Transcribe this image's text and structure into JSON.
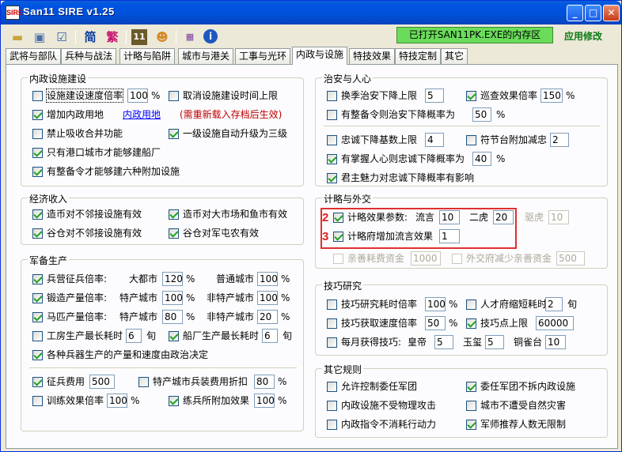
{
  "window": {
    "title": "San11 SIRE v1.25",
    "app_icon": "SIRE"
  },
  "toolbar": {
    "icons": [
      "open-folder-icon",
      "save-disk-icon",
      "checklist-icon",
      "simplified-icon",
      "traditional-icon",
      "calendar-11-icon",
      "officer-face-icon",
      "binary-grid-icon",
      "info-icon"
    ],
    "simplified": "简",
    "traditional": "繁",
    "status": "已打开SAN11PK.EXE的内存区",
    "apply": "应用修改"
  },
  "tabs": [
    "武将与部队",
    "兵种与战法",
    "计略与陷阱",
    "城市与港关",
    "工事与光环",
    "内政与设施",
    "特技效果",
    "特技定制",
    "其它"
  ],
  "active_tab": "内政与设施",
  "left": {
    "g1": {
      "title": "内政设施建设",
      "r1": {
        "label": "设施建设速度倍率",
        "value": "100",
        "unit": "%"
      },
      "r1b": {
        "label": "取消设施建设时间上限"
      },
      "r2": {
        "label": "增加内政用地",
        "link": "内政用地",
        "note": "(需重新载入存档后生效)"
      },
      "r3": {
        "label": "禁止吸收合并功能"
      },
      "r3b": {
        "label": "一级设施自动升级为三级"
      },
      "r4": {
        "label": "只有港口城市才能够建船厂"
      },
      "r5": {
        "label": "有整备令才能够建六种附加设施"
      }
    },
    "g2": {
      "title": "经济收入",
      "a": "造币对不邻接设施有效",
      "b": "造币对大市场和鱼市有效",
      "c": "谷仓对不邻接设施有效",
      "d": "谷仓对军屯农有效"
    },
    "g3": {
      "title": "军备生产",
      "r1": {
        "label": "兵营征兵倍率:",
        "city1": "大都市",
        "v1": "120",
        "city2": "普通城市",
        "v2": "100"
      },
      "r2": {
        "label": "锻造产量倍率:",
        "city1": "特产城市",
        "v1": "100",
        "city2": "非特产城市",
        "v2": "100"
      },
      "r3": {
        "label": "马匹产量倍率:",
        "city1": "特产城市",
        "v1": "80",
        "city2": "非特产城市",
        "v2": "20"
      },
      "r4": {
        "label": "工房生产最长耗时",
        "v1": "6",
        "unit1": "旬",
        "label2": "船厂生产最长耗时",
        "v2": "6",
        "unit2": "旬"
      },
      "r5": {
        "label": "各种兵器生产的产量和速度由政治决定"
      },
      "r6": {
        "label": "征兵费用",
        "v": "500",
        "label2": "特产城市兵装费用折扣",
        "v2": "80"
      },
      "r7": {
        "label": "训练效果倍率",
        "v": "100",
        "label2": "练兵所附加效果",
        "v2": "100"
      },
      "pct": "%"
    }
  },
  "right": {
    "g1": {
      "title": "治安与人心",
      "r1": {
        "label": "换季治安下降上限",
        "v": "5",
        "label2": "巡查效果倍率",
        "v2": "150"
      },
      "r2": {
        "label": "有整备令则治安下降概率为",
        "v": "50"
      },
      "r3": {
        "label": "忠诚下降基数上限",
        "v": "4",
        "label2": "符节台附加减忠",
        "v2": "2"
      },
      "r4": {
        "label": "有掌握人心则忠诚下降概率为",
        "v": "40"
      },
      "r5": {
        "label": "君主魅力对忠诚下降概率有影响"
      },
      "pct": "%"
    },
    "g2": {
      "title": "计略与外交",
      "r1": {
        "label": "计略效果参数:",
        "a": "流言",
        "av": "10",
        "b": "二虎",
        "bv": "20",
        "c": "驱虎",
        "cv": "10"
      },
      "r2": {
        "label": "计略府增加流言效果",
        "v": "1"
      },
      "r3": {
        "label": "亲善耗费资金",
        "v": "1000",
        "label2": "外交府减少亲善资金",
        "v2": "500"
      },
      "marks": [
        "2",
        "3"
      ]
    },
    "g3": {
      "title": "技巧研究",
      "r1": {
        "label": "技巧研究耗时倍率",
        "v": "100",
        "label2": "人才府缩短耗时",
        "v2": "2",
        "unit": "旬"
      },
      "r2": {
        "label": "技巧获取速度倍率",
        "v": "50",
        "label2": "技巧点上限",
        "v2": "60000"
      },
      "r3": {
        "label": "每月获得技巧:",
        "a": "皇帝",
        "av": "5",
        "b": "玉玺",
        "bv": "5",
        "c": "铜雀台",
        "cv": "10"
      },
      "pct": "%"
    },
    "g4": {
      "title": "其它规则",
      "a": "允许控制委任军团",
      "b": "委任军团不拆内政设施",
      "c": "内政设施不受物理攻击",
      "d": "城市不遭受自然灾害",
      "e": "内政指令不消耗行动力",
      "f": "军师推荐人数无限制"
    }
  }
}
